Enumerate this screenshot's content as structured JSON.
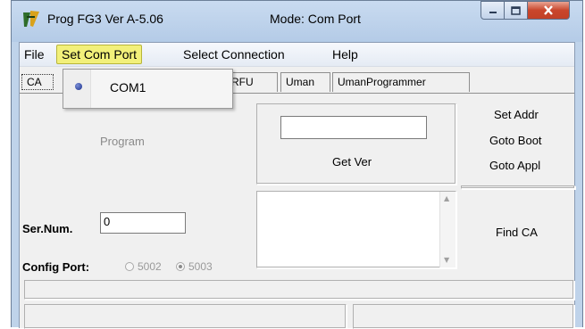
{
  "window": {
    "title": "Prog FG3  Ver A-5.06",
    "mode": "Mode: Com Port"
  },
  "menu": {
    "file": "File",
    "set_com_port": "Set Com Port",
    "select_connection": "Select Connection",
    "help": "Help"
  },
  "dropdown": {
    "items": [
      {
        "label": "COM1",
        "checked": true
      }
    ]
  },
  "tabs": [
    "CA",
    "RFU",
    "Uman",
    "UmanProgrammer"
  ],
  "panel": {
    "program_label": "Program",
    "get_ver_label": "Get Ver",
    "ver_value": "",
    "set_addr_label": "Set Addr",
    "goto_boot_label": "Goto Boot",
    "goto_appl_label": "Goto Appl",
    "find_ca_label": "Find CA",
    "ser_num_label": "Ser.Num.",
    "ser_num_value": "0",
    "config_port_label": "Config Port:",
    "port_options": [
      "5002",
      "5003"
    ],
    "selected_port": "5003"
  },
  "colors": {
    "titlebar": "#bfd3ea",
    "menu_highlight": "#f2f07a",
    "close_button": "#c9462c"
  }
}
